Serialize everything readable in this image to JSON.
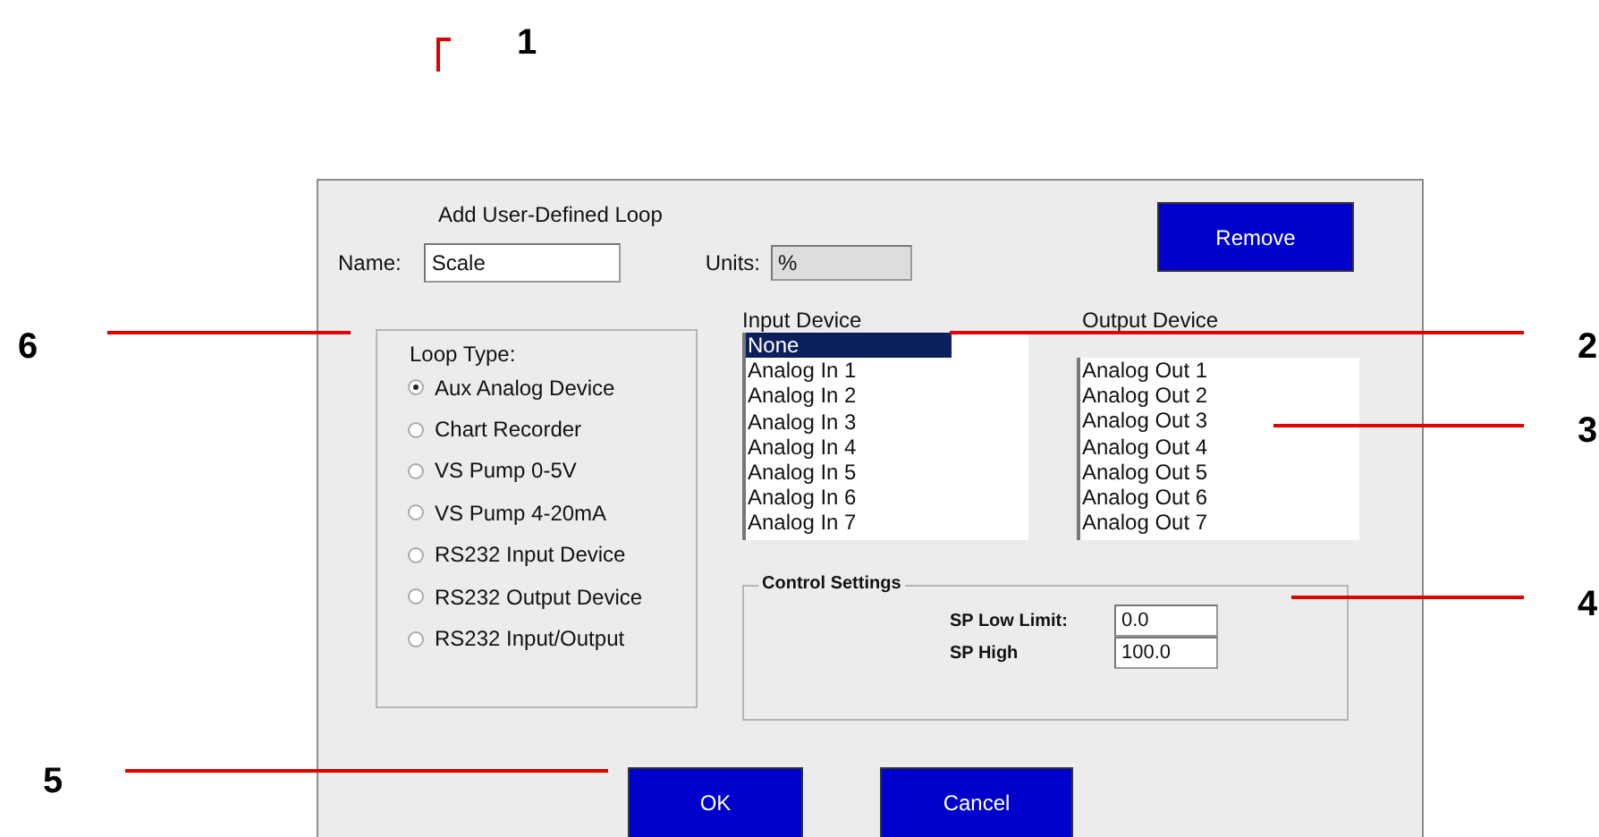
{
  "dialog": {
    "title": "Add User-Defined Loop",
    "name_field": {
      "label": "Name:",
      "value": "Scale"
    },
    "units_field": {
      "label": "Units:",
      "value": "%"
    },
    "remove_button": "Remove",
    "loop_type": {
      "label": "Loop Type:",
      "options": [
        {
          "label": "Aux Analog Device",
          "selected": true
        },
        {
          "label": "Chart Recorder",
          "selected": false
        },
        {
          "label": "VS Pump 0-5V",
          "selected": false
        },
        {
          "label": "VS Pump 4-20mA",
          "selected": false
        },
        {
          "label": "RS232 Input Device",
          "selected": false
        },
        {
          "label": "RS232 Output Device",
          "selected": false
        },
        {
          "label": "RS232 Input/Output",
          "selected": false
        }
      ]
    },
    "input_device": {
      "label": "Input Device",
      "items": [
        {
          "label": "None",
          "selected": true
        },
        {
          "label": "Analog In 1",
          "selected": false
        },
        {
          "label": "Analog In 2",
          "selected": false
        },
        {
          "label": "Analog In 3",
          "selected": false
        },
        {
          "label": "Analog In 4",
          "selected": false
        },
        {
          "label": "Analog In 5",
          "selected": false
        },
        {
          "label": "Analog In 6",
          "selected": false
        },
        {
          "label": "Analog In 7",
          "selected": false
        }
      ]
    },
    "output_device": {
      "label": "Output Device",
      "items": [
        {
          "label": "Analog Out 1",
          "selected": false
        },
        {
          "label": "Analog Out 2",
          "selected": false
        },
        {
          "label": "Analog Out 3",
          "selected": false
        },
        {
          "label": "Analog Out 4",
          "selected": false
        },
        {
          "label": "Analog Out 5",
          "selected": false
        },
        {
          "label": "Analog Out 6",
          "selected": false
        },
        {
          "label": "Analog Out 7",
          "selected": false
        }
      ]
    },
    "control_settings": {
      "title": "Control Settings",
      "fields": [
        {
          "label": "SP Low Limit:",
          "value": "0.0"
        },
        {
          "label": "SP High",
          "value": "100.0"
        }
      ]
    },
    "buttons": [
      "OK",
      "Cancel"
    ]
  },
  "callouts": [
    {
      "label": "1"
    },
    {
      "label": "2"
    },
    {
      "label": "3"
    },
    {
      "label": "4"
    },
    {
      "label": "5"
    },
    {
      "label": "6"
    }
  ]
}
